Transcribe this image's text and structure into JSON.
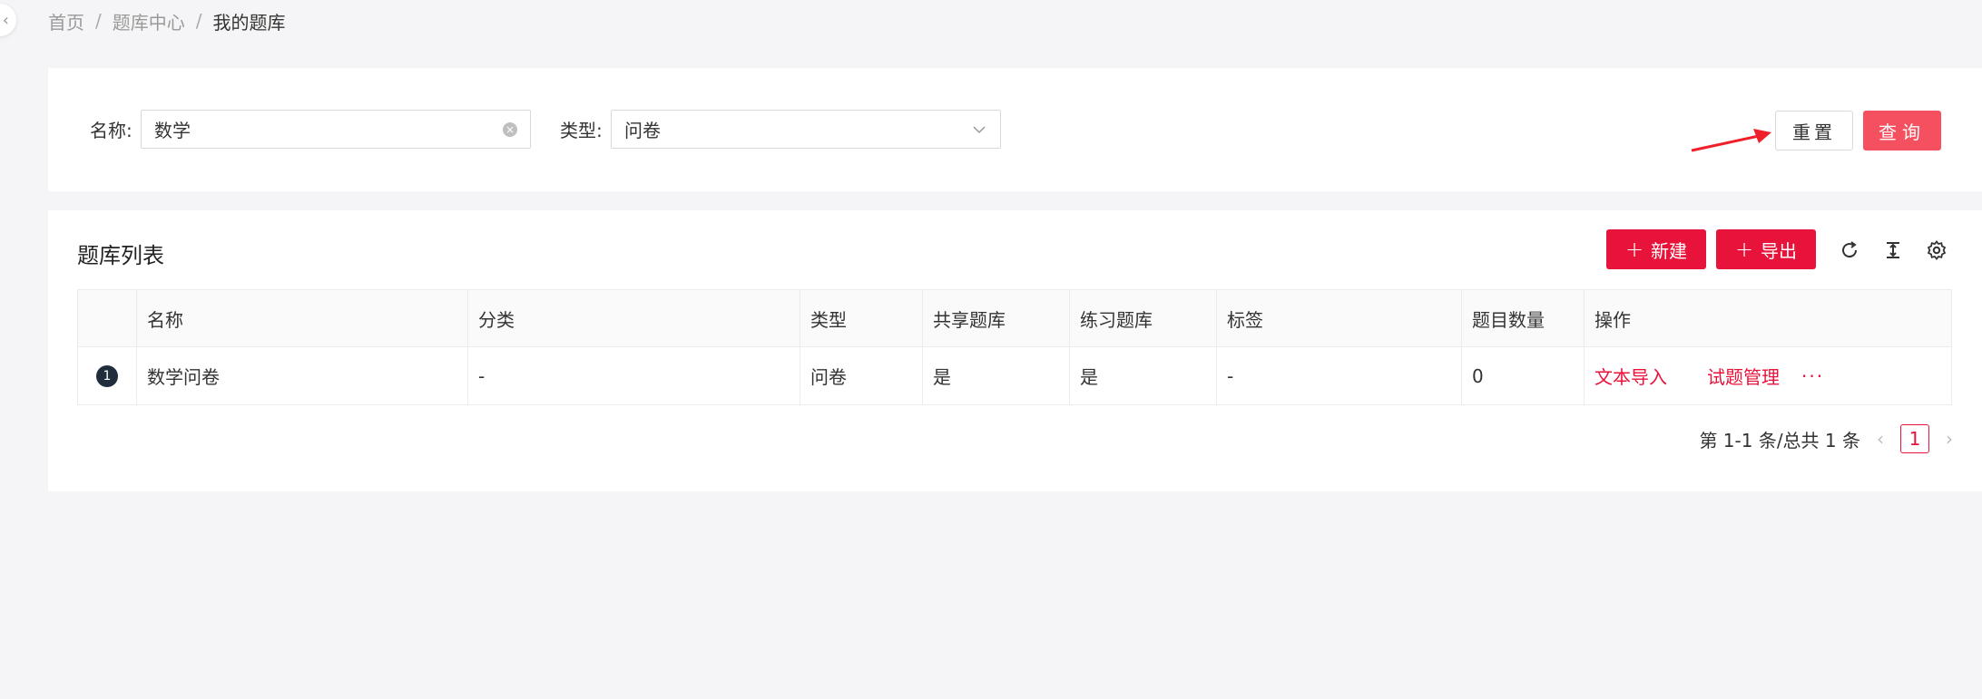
{
  "breadcrumb": {
    "home": "首页",
    "center": "题库中心",
    "current": "我的题库",
    "separator": "/"
  },
  "search": {
    "name_label": "名称:",
    "name_value": "数学",
    "type_label": "类型:",
    "type_value": "问卷",
    "reset_label": "重置",
    "query_label": "查询"
  },
  "list": {
    "title": "题库列表",
    "new_label": "新建",
    "export_label": "导出",
    "columns": [
      "名称",
      "分类",
      "类型",
      "共享题库",
      "练习题库",
      "标签",
      "题目数量",
      "操作"
    ],
    "rows": [
      {
        "index": "1",
        "name": "数学问卷",
        "category": "-",
        "type": "问卷",
        "shared": "是",
        "practice": "是",
        "tags": "-",
        "count": "0",
        "action_import": "文本导入",
        "action_manage": "试题管理",
        "action_more": "···"
      }
    ]
  },
  "pagination": {
    "summary": "第 1-1 条/总共 1 条",
    "current_page": "1",
    "prev": "‹",
    "next": "›"
  },
  "colors": {
    "primary": "#e8133a",
    "query_button": "#f5505f",
    "annotation_arrow": "#f0202a"
  }
}
